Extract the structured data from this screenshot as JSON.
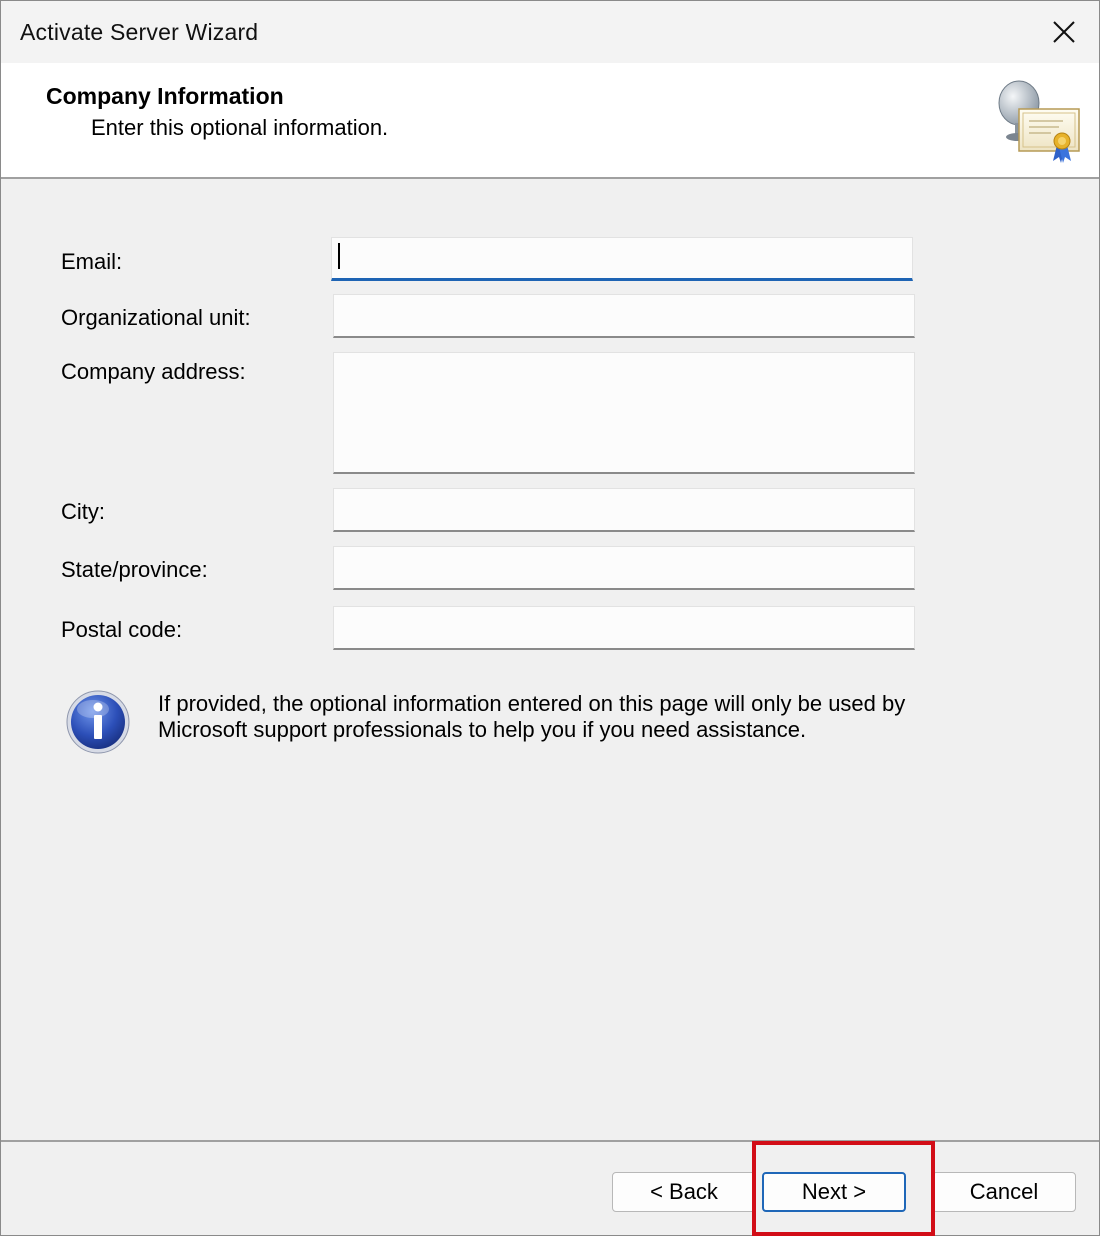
{
  "window": {
    "title": "Activate Server Wizard",
    "close_icon": "close-icon"
  },
  "header": {
    "title": "Company Information",
    "subtitle": "Enter this optional information.",
    "icon": "server-certificate-icon"
  },
  "form": {
    "fields": [
      {
        "label": "Email:",
        "value": "",
        "focused": true
      },
      {
        "label": "Organizational unit:",
        "value": ""
      },
      {
        "label": "Company address:",
        "value": ""
      },
      {
        "label": "City:",
        "value": ""
      },
      {
        "label": "State/province:",
        "value": ""
      },
      {
        "label": "Postal code:",
        "value": ""
      }
    ]
  },
  "info": {
    "icon": "info-icon",
    "text": "If provided, the optional information entered on this page will only be used by Microsoft support professionals to help you if you need assistance."
  },
  "buttons": {
    "back": "< Back",
    "next": "Next >",
    "cancel": "Cancel"
  },
  "colors": {
    "focus_accent": "#1e64b4",
    "highlight": "#d20d17",
    "dialog_bg": "#f0f0f0"
  }
}
